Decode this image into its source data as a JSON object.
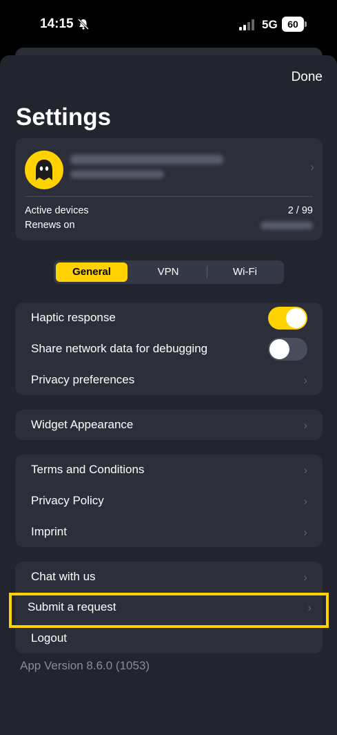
{
  "status_bar": {
    "time": "14:15",
    "network": "5G",
    "battery": "60",
    "icons": [
      "bell-slash-icon",
      "signal-icon",
      "battery-icon"
    ]
  },
  "header": {
    "done_label": "Done",
    "title": "Settings"
  },
  "account": {
    "active_devices_label": "Active devices",
    "active_devices_value": "2 / 99",
    "renews_label": "Renews on"
  },
  "tabs": [
    {
      "label": "General",
      "active": true
    },
    {
      "label": "VPN",
      "active": false
    },
    {
      "label": "Wi-Fi",
      "active": false
    }
  ],
  "groups": {
    "toggles": {
      "haptic_label": "Haptic response",
      "haptic_on": true,
      "share_label": "Share network data for debugging",
      "share_on": false,
      "privacy_prefs_label": "Privacy preferences"
    },
    "widget": {
      "widget_label": "Widget Appearance"
    },
    "legal": {
      "terms_label": "Terms and Conditions",
      "privacy_policy_label": "Privacy Policy",
      "imprint_label": "Imprint"
    },
    "support": {
      "chat_label": "Chat with us",
      "submit_label": "Submit a request",
      "logout_label": "Logout"
    }
  },
  "chevron": "›",
  "app_version": "App Version 8.6.0 (1053)",
  "colors": {
    "accent": "#ffd200",
    "sheet_bg": "#22242e",
    "card_bg": "#2c2e39"
  }
}
